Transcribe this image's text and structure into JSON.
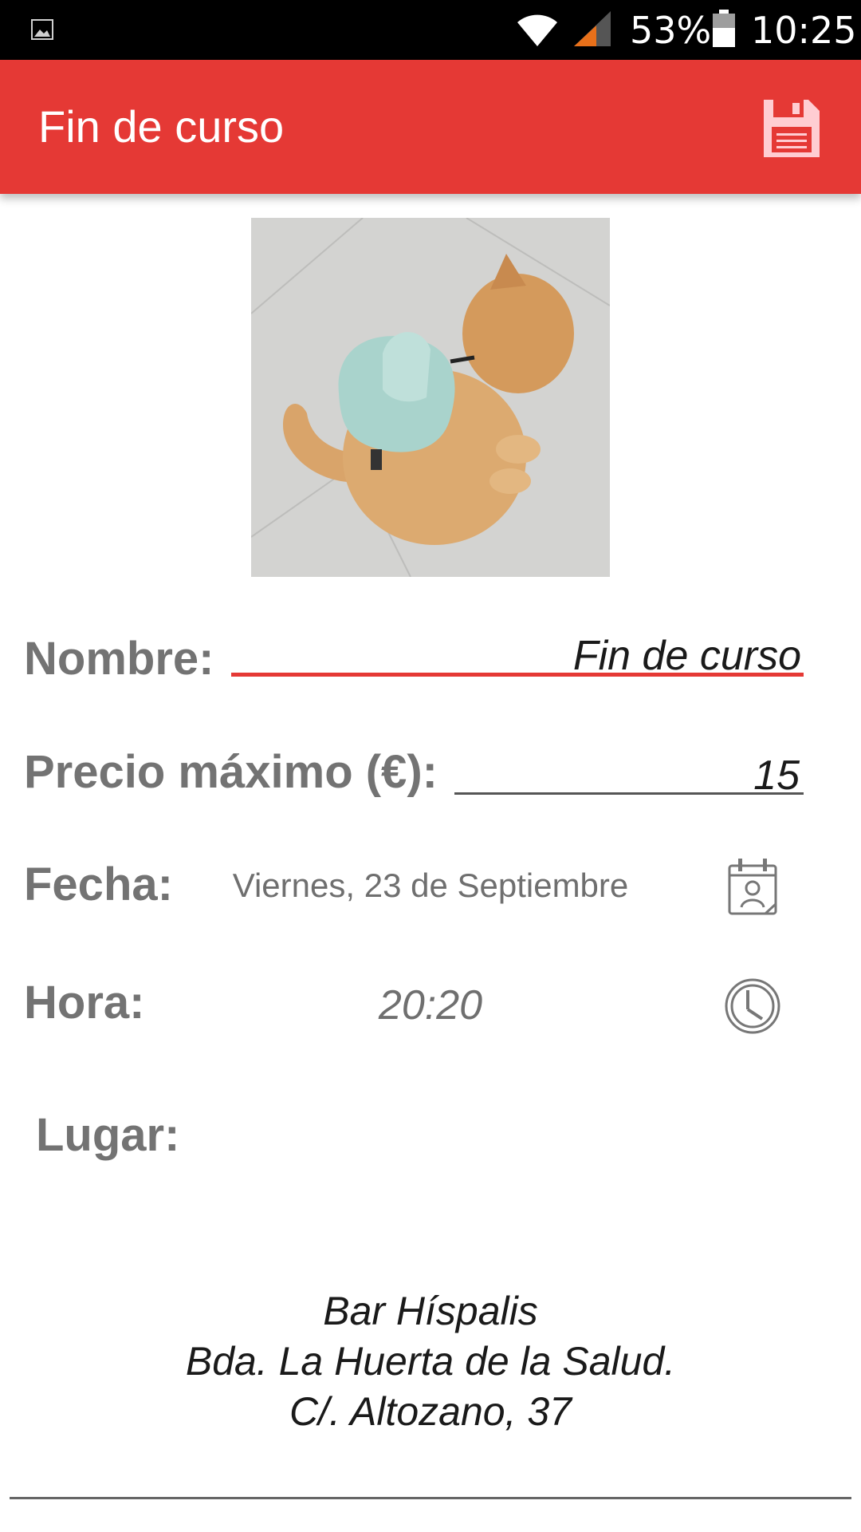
{
  "status_bar": {
    "battery_percent": "53%",
    "time": "10:25",
    "icons": [
      "gallery-notification-icon",
      "wifi-icon",
      "cell-signal-icon",
      "battery-icon"
    ]
  },
  "app_bar": {
    "title": "Fin de curso",
    "background_color": "#e53935",
    "action_icon": "save-icon"
  },
  "form": {
    "photo": {
      "description_icon": "event-photo"
    },
    "name": {
      "label": "Nombre:",
      "value": "Fin de curso"
    },
    "price": {
      "label": "Precio máximo (€):",
      "value": "15"
    },
    "date": {
      "label": "Fecha:",
      "value": "Viernes, 23 de Septiembre",
      "icon": "calendar-icon"
    },
    "time": {
      "label": "Hora:",
      "value": "20:20",
      "icon": "clock-icon"
    },
    "place": {
      "label": "Lugar:",
      "value": "Bar Híspalis\nBda. La Huerta de la Salud.\nC/. Altozano, 37"
    }
  }
}
